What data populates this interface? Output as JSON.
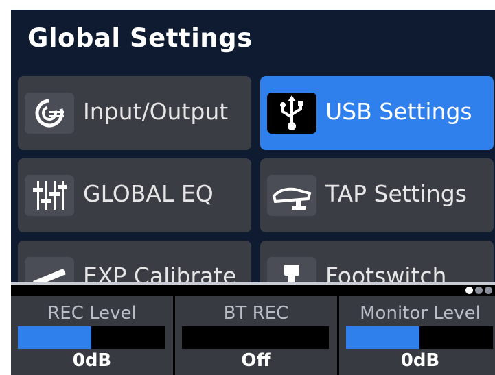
{
  "header": {
    "title": "Global Settings"
  },
  "tiles": [
    {
      "label": "Input/Output",
      "icon": "input-output-icon",
      "active": false
    },
    {
      "label": "USB Settings",
      "icon": "usb-icon",
      "active": true
    },
    {
      "label": "GLOBAL EQ",
      "icon": "equalizer-sliders-icon",
      "active": false
    },
    {
      "label": "TAP Settings",
      "icon": "tap-pedal-icon",
      "active": false
    },
    {
      "label": "EXP Calibrate",
      "icon": "expression-pedal-icon",
      "active": false
    },
    {
      "label": "Footswitch",
      "icon": "footswitch-icon",
      "active": false
    }
  ],
  "pager": {
    "page_count": 3,
    "current_page": 1
  },
  "bottom_panels": [
    {
      "label": "REC Level",
      "value": "0dB",
      "level": 0.5
    },
    {
      "label": "BT REC",
      "value": "Off",
      "level": 0
    },
    {
      "label": "Monitor Level",
      "value": "0dB",
      "level": 0.5
    }
  ],
  "colors": {
    "accent": "#2f80ed",
    "header_bg": "#0e1b30",
    "tile_bg": "#3a3d44",
    "panel_bg": "#373a40"
  }
}
